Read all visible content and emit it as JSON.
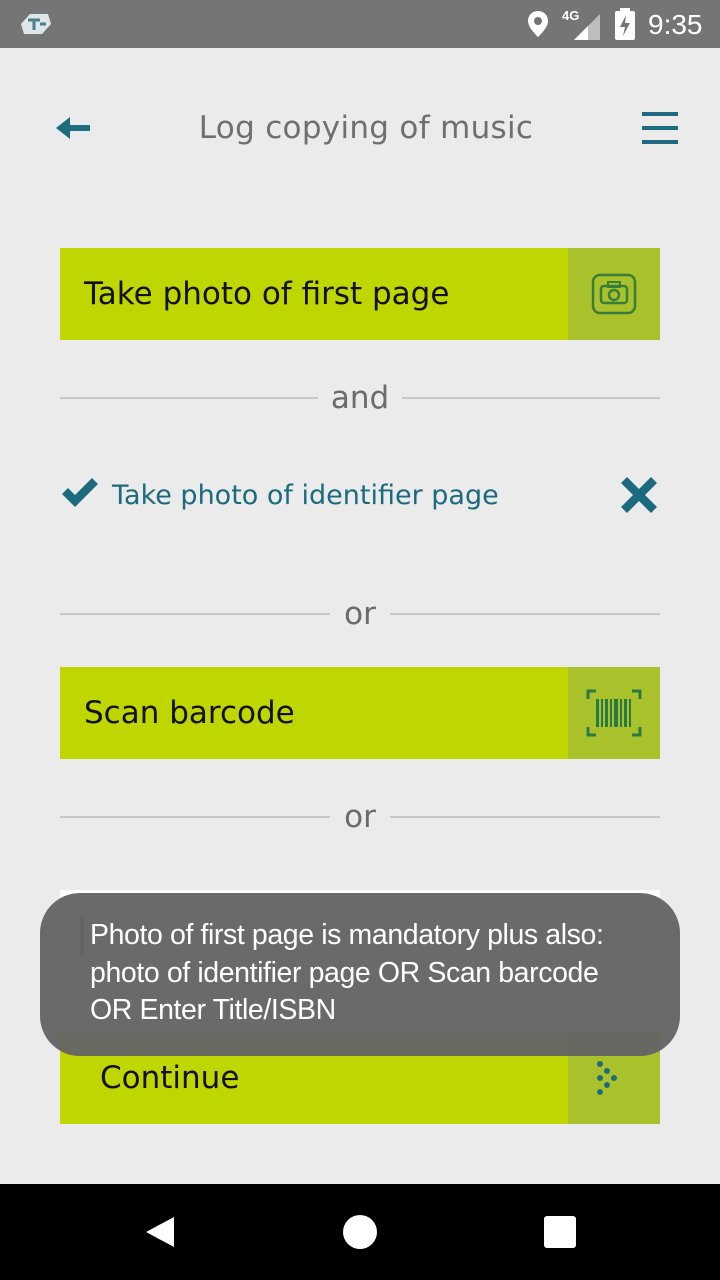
{
  "status_bar": {
    "network_label": "4G",
    "time": "9:35"
  },
  "header": {
    "title": "Log copying of music"
  },
  "actions": {
    "first_page_label": "Take photo of first page",
    "identifier_label": "Take photo of identifier page",
    "barcode_label": "Scan barcode",
    "continue_label": "Continue"
  },
  "separators": {
    "and": "and",
    "or_1": "or",
    "or_2": "or"
  },
  "title_input": {
    "placeholder": ""
  },
  "toast": {
    "line1": "Photo of first page is mandatory plus also:",
    "line2": "photo of identifier page OR Scan barcode",
    "line3": "OR Enter Title/ISBN"
  },
  "colors": {
    "accent_green": "#bfd600",
    "accent_dark_green": "#a9c22b",
    "brand_teal": "#1f6c7f"
  }
}
